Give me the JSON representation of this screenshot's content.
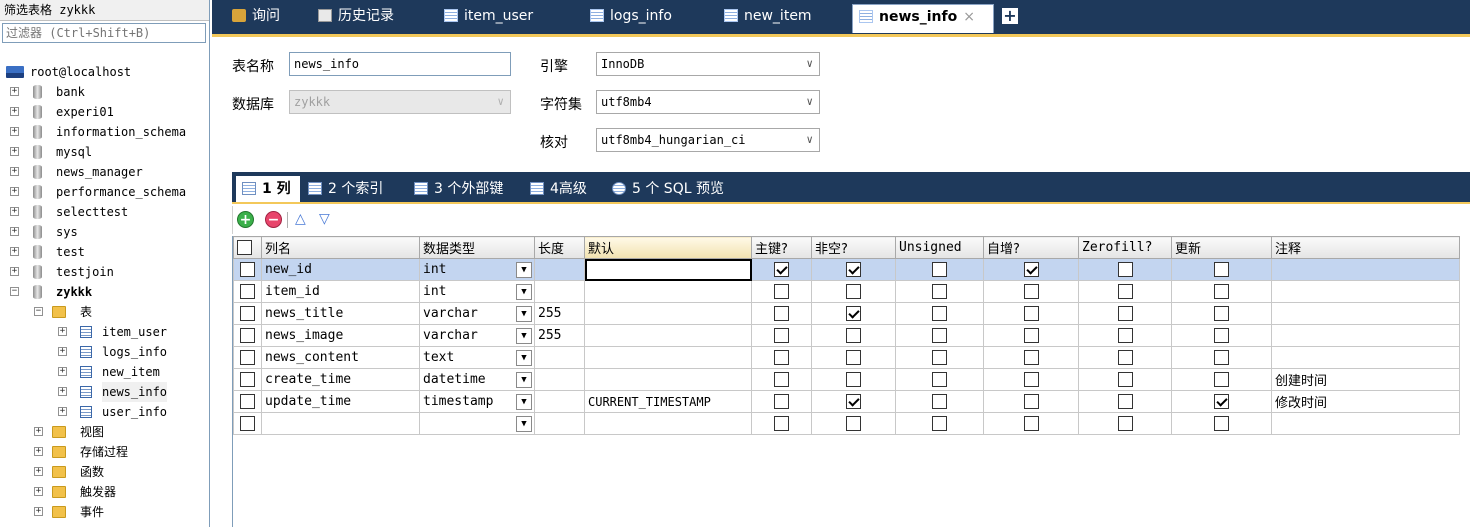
{
  "sidebar": {
    "filter_label": "筛选表格 zykkk",
    "filter_placeholder": "过滤器 (Ctrl+Shift+B)",
    "host": "root@localhost",
    "databases": [
      "bank",
      "experi01",
      "information_schema",
      "mysql",
      "news_manager",
      "performance_schema",
      "selecttest",
      "sys",
      "test",
      "testjoin"
    ],
    "current_db": "zykkk",
    "tables_folder": "表",
    "tables": [
      "item_user",
      "logs_info",
      "new_item",
      "news_info",
      "user_info"
    ],
    "other_folders": [
      "视图",
      "存储过程",
      "函数",
      "触发器",
      "事件"
    ]
  },
  "tabs": [
    {
      "label": "询问",
      "icon": "query-icon"
    },
    {
      "label": "历史记录",
      "icon": "history-icon"
    },
    {
      "label": "item_user",
      "icon": "table-icon"
    },
    {
      "label": "logs_info",
      "icon": "table-icon"
    },
    {
      "label": "new_item",
      "icon": "table-icon"
    },
    {
      "label": "news_info",
      "icon": "table-icon",
      "close": "×"
    }
  ],
  "add_tab": "+",
  "form": {
    "table_name_label": "表名称",
    "table_name_value": "news_info",
    "database_label": "数据库",
    "database_value": "zykkk",
    "engine_label": "引擎",
    "engine_value": "InnoDB",
    "charset_label": "字符集",
    "charset_value": "utf8mb4",
    "collation_label": "核对",
    "collation_value": "utf8mb4_hungarian_ci"
  },
  "subtabs": [
    {
      "label": "1 列"
    },
    {
      "label": "2 个索引"
    },
    {
      "label": "3 个外部键"
    },
    {
      "label": "4高级"
    },
    {
      "label": "5 个 SQL 预览"
    }
  ],
  "toolbar": {
    "add": "+",
    "remove": "−",
    "up": "△",
    "down": "▽"
  },
  "grid": {
    "headers": [
      "列名",
      "数据类型",
      "长度",
      "默认",
      "主键?",
      "非空?",
      "Unsigned",
      "自增?",
      "Zerofill?",
      "更新",
      "注释"
    ],
    "rows": [
      {
        "name": "new_id",
        "type": "int",
        "length": "",
        "default": "",
        "pk": true,
        "nn": true,
        "unsigned": false,
        "ai": true,
        "zerofill": false,
        "update": false,
        "comment": ""
      },
      {
        "name": "item_id",
        "type": "int",
        "length": "",
        "default": "",
        "pk": false,
        "nn": false,
        "unsigned": false,
        "ai": false,
        "zerofill": false,
        "update": false,
        "comment": ""
      },
      {
        "name": "news_title",
        "type": "varchar",
        "length": "255",
        "default": "",
        "pk": false,
        "nn": true,
        "unsigned": false,
        "ai": false,
        "zerofill": false,
        "update": false,
        "comment": ""
      },
      {
        "name": "news_image",
        "type": "varchar",
        "length": "255",
        "default": "",
        "pk": false,
        "nn": false,
        "unsigned": false,
        "ai": false,
        "zerofill": false,
        "update": false,
        "comment": ""
      },
      {
        "name": "news_content",
        "type": "text",
        "length": "",
        "default": "",
        "pk": false,
        "nn": false,
        "unsigned": false,
        "ai": false,
        "zerofill": false,
        "update": false,
        "comment": ""
      },
      {
        "name": "create_time",
        "type": "datetime",
        "length": "",
        "default": "",
        "pk": false,
        "nn": false,
        "unsigned": false,
        "ai": false,
        "zerofill": false,
        "update": false,
        "comment": "创建时间"
      },
      {
        "name": "update_time",
        "type": "timestamp",
        "length": "",
        "default": "CURRENT_TIMESTAMP",
        "pk": false,
        "nn": true,
        "unsigned": false,
        "ai": false,
        "zerofill": false,
        "update": true,
        "comment": "修改时间"
      },
      {
        "name": "",
        "type": "",
        "length": "",
        "default": "",
        "pk": false,
        "nn": false,
        "unsigned": false,
        "ai": false,
        "zerofill": false,
        "update": false,
        "comment": ""
      }
    ]
  },
  "colors": {
    "tabbar": "#1e395b",
    "accent": "#f3c85a",
    "selected_row": "#c3d5f0"
  }
}
